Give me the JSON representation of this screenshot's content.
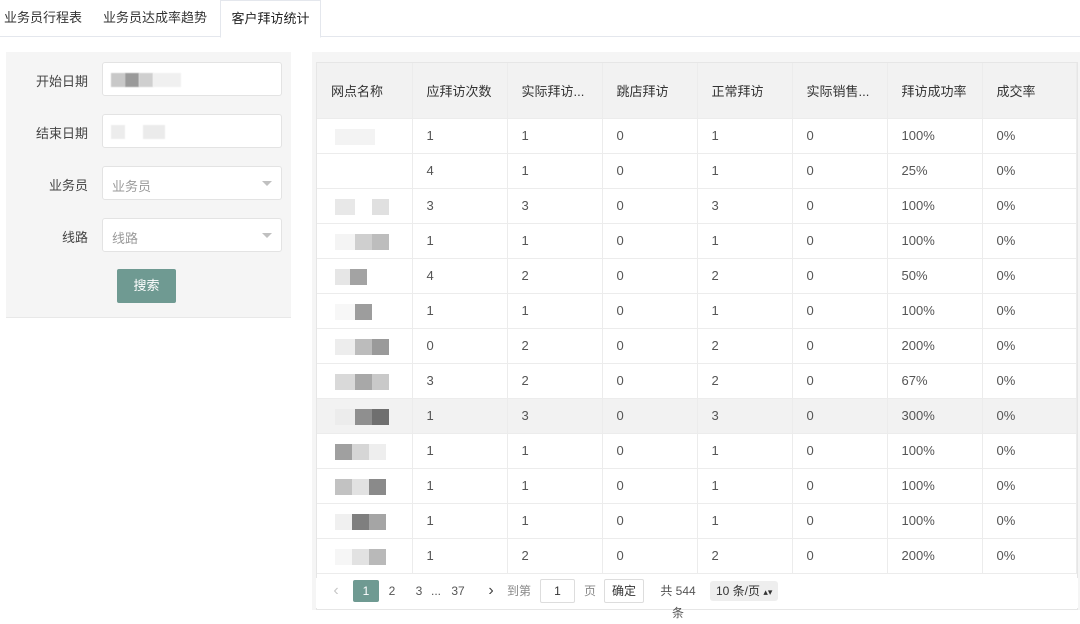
{
  "tabs": [
    {
      "label": "业务员行程表"
    },
    {
      "label": "业务员达成率趋势"
    },
    {
      "label": "客户拜访统计"
    }
  ],
  "filters": {
    "start_date_label": "开始日期",
    "end_date_label": "结束日期",
    "salesperson_label": "业务员",
    "salesperson_placeholder": "业务员",
    "route_label": "线路",
    "route_placeholder": "线路",
    "search_button": "搜索"
  },
  "table": {
    "columns": [
      "网点名称",
      "应拜访次数",
      "实际拜访...",
      "跳店拜访",
      "正常拜访",
      "实际销售...",
      "拜访成功率",
      "成交率"
    ],
    "rows": [
      [
        "",
        "1",
        "1",
        "0",
        "1",
        "0",
        "100%",
        "0%"
      ],
      [
        "",
        "4",
        "1",
        "0",
        "1",
        "0",
        "25%",
        "0%"
      ],
      [
        "",
        "3",
        "3",
        "0",
        "3",
        "0",
        "100%",
        "0%"
      ],
      [
        "",
        "1",
        "1",
        "0",
        "1",
        "0",
        "100%",
        "0%"
      ],
      [
        "",
        "4",
        "2",
        "0",
        "2",
        "0",
        "50%",
        "0%"
      ],
      [
        "",
        "1",
        "1",
        "0",
        "1",
        "0",
        "100%",
        "0%"
      ],
      [
        "",
        "0",
        "2",
        "0",
        "2",
        "0",
        "200%",
        "0%"
      ],
      [
        "",
        "3",
        "2",
        "0",
        "2",
        "0",
        "67%",
        "0%"
      ],
      [
        "",
        "1",
        "3",
        "0",
        "3",
        "0",
        "300%",
        "0%"
      ],
      [
        "",
        "1",
        "1",
        "0",
        "1",
        "0",
        "100%",
        "0%"
      ],
      [
        "",
        "1",
        "1",
        "0",
        "1",
        "0",
        "100%",
        "0%"
      ],
      [
        "",
        "1",
        "1",
        "0",
        "1",
        "0",
        "100%",
        "0%"
      ],
      [
        "",
        "1",
        "2",
        "0",
        "2",
        "0",
        "200%",
        "0%"
      ]
    ],
    "highlighted_row": 8
  },
  "pagination": {
    "pages": [
      "1",
      "2",
      "3",
      "...",
      "37"
    ],
    "current_page": "1",
    "goto_label": "到第",
    "goto_value": "1",
    "page_unit": "页",
    "confirm_button": "确定",
    "total_text": "共 544 条",
    "page_size": "10 条/页"
  },
  "colors": {
    "accent": "#6f9a92",
    "header_bg": "#f2f2f2",
    "panel_bg": "#f5f5f5"
  }
}
